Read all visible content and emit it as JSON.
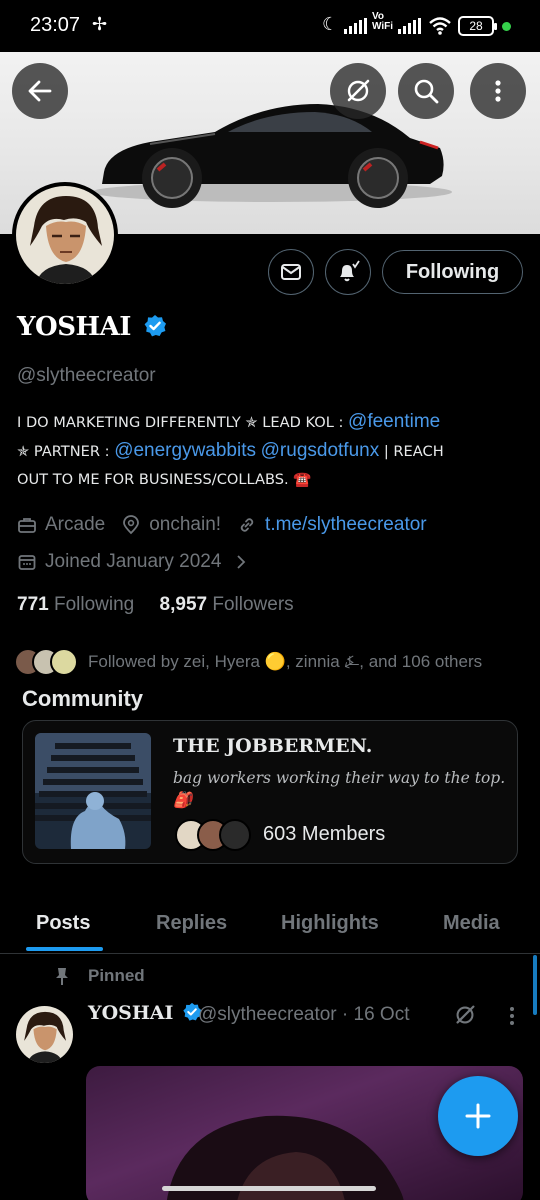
{
  "status_bar": {
    "time": "23:07",
    "network_label_top": "Vo",
    "network_label_bottom": "WiFi",
    "battery": "28"
  },
  "header": {
    "back_icon": "arrow-left-icon",
    "grok_icon": "grok-icon",
    "search_icon": "search-icon",
    "more_icon": "more-vertical-icon"
  },
  "profile": {
    "name": "YOSHAI",
    "verified": true,
    "handle": "@slytheecreator",
    "bio": {
      "line1_text": "I DO MARKETING DIFFERENTLY ✯ LEAD KOL : ",
      "line1_link": "@feentime",
      "line2_text": "✯ PARTNER : ",
      "line2_link1": "@energywabbits",
      "line2_link2": "@rugsdotfunx",
      "line2_tail": " | REACH",
      "line3_text": "OUT TO ME FOR BUSINESS/COLLABS. ☎️"
    },
    "category": "Arcade",
    "location": "onchain!",
    "website": "t.me/slytheecreator",
    "joined": "Joined January 2024",
    "following_count": "771",
    "following_label": "Following",
    "followers_count": "8,957",
    "followers_label": "Followers",
    "followed_by": "Followed by zei, Hyera 🟡, zinnia ⍼, and 106 others"
  },
  "actions": {
    "message_icon": "envelope-icon",
    "notify_icon": "bell-plus-icon",
    "following_label": "Following"
  },
  "community": {
    "section_title": "Community",
    "name": "THE JOBBERMEN.",
    "description": "bag workers working their way to the top. 🎒",
    "members": "603 Members"
  },
  "tabs": [
    {
      "label": "Posts",
      "active": true
    },
    {
      "label": "Replies",
      "active": false
    },
    {
      "label": "Highlights",
      "active": false
    },
    {
      "label": "Media",
      "active": false
    }
  ],
  "pinned_post": {
    "pinned_label": "Pinned",
    "author": "YOSHAI",
    "handle_date": "@slytheecreator · 16 Oct"
  },
  "colors": {
    "accent": "#1d9bf0",
    "link": "#4a99e9",
    "muted": "#71767b",
    "background": "#000000"
  }
}
